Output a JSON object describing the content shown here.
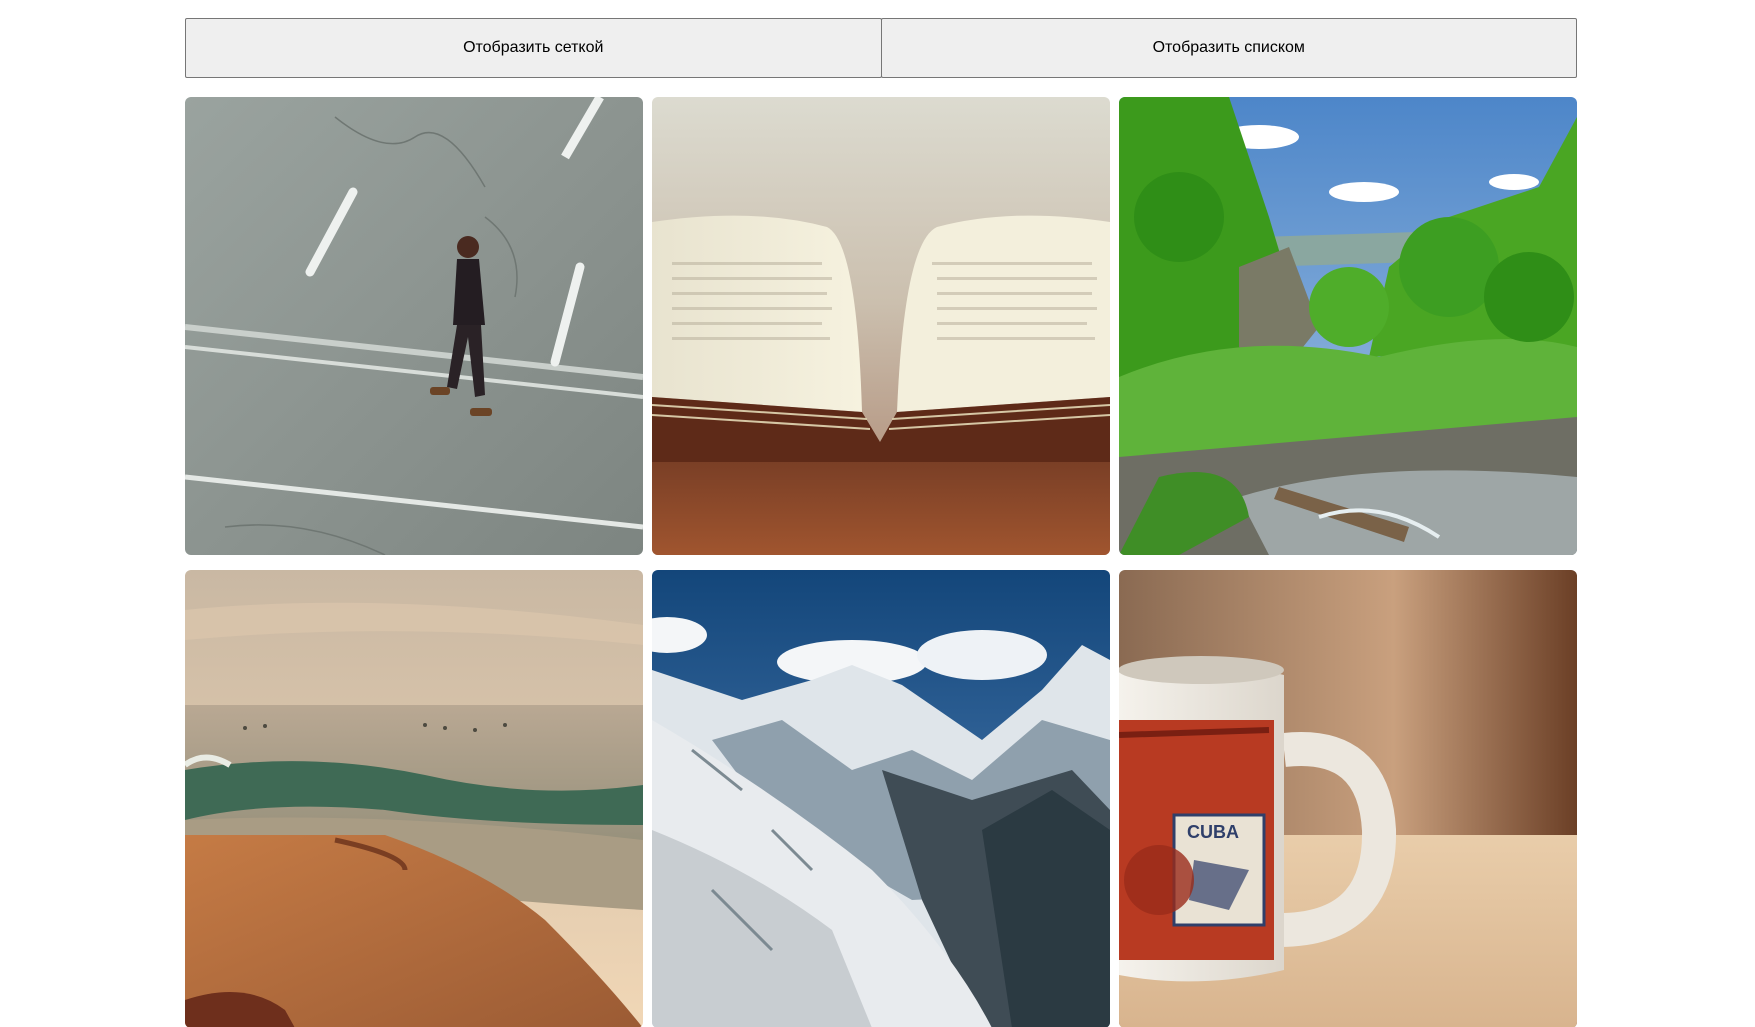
{
  "toolbar": {
    "grid_label": "Отобразить сеткой",
    "list_label": "Отобразить списком"
  },
  "gallery": {
    "photos": [
      {
        "subject": "man walking across road"
      },
      {
        "subject": "open book on table"
      },
      {
        "subject": "green forest and mountain stream"
      },
      {
        "subject": "sea waves and sandy shore at sunset"
      },
      {
        "subject": "snowy mountain range"
      },
      {
        "subject": "Cuba stamp coffee mug"
      }
    ],
    "mug_stamp_text": "CUBA"
  }
}
